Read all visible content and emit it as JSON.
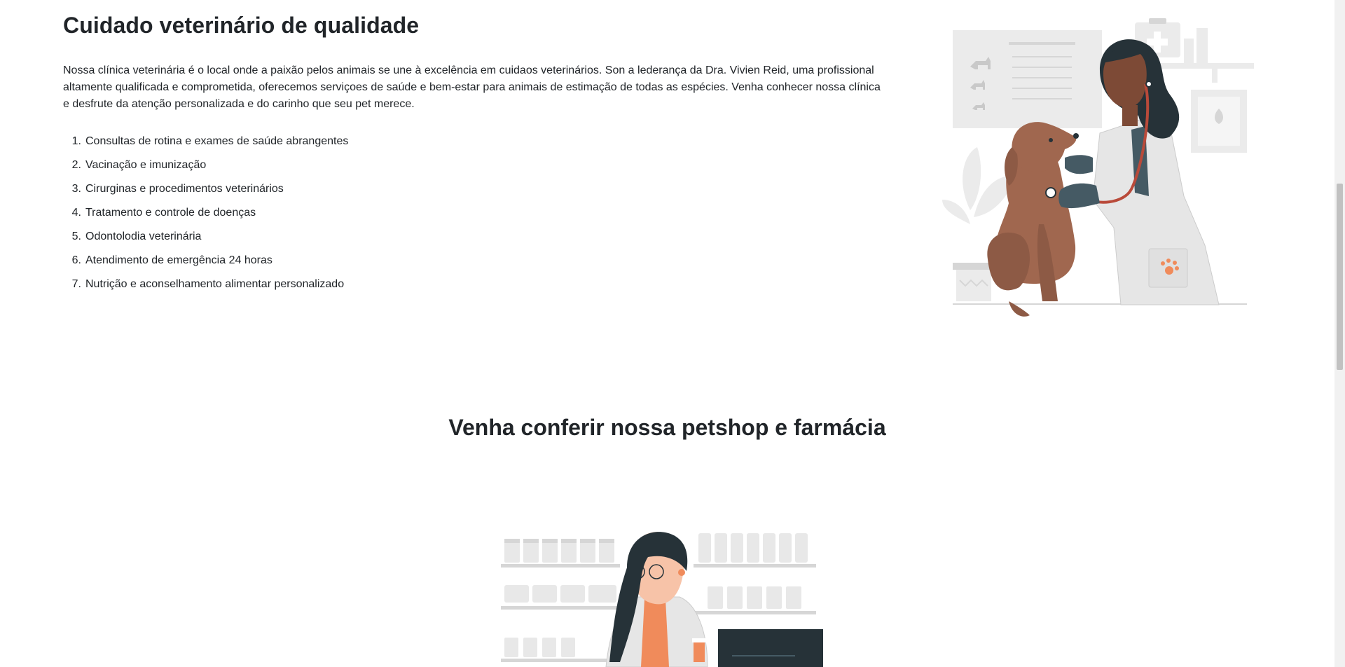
{
  "vet_section": {
    "title": "Cuidado veterinário de qualidade",
    "description": "Nossa clínica veterinária é o local onde a paixão pelos animais se une à excelência em cuidaos veterinários. Son a lederança da Dra. Vivien Reid, uma profissional altamente qualificada e comprometida, oferecemos serviçoes de saúde e bem-estar para animais de estimação de todas as espécies. Venha conhecer nossa clínica e desfrute da atenção personalizada e do carinho que seu pet merece.",
    "services": [
      {
        "number": "1.",
        "label": "Consultas de rotina e exames de saúde abrangentes"
      },
      {
        "number": "2.",
        "label": "Vacinação e imunização"
      },
      {
        "number": "3.",
        "label": "Cirurginas e procedimentos veterinários"
      },
      {
        "number": "4.",
        "label": "Tratamento e controle de doenças"
      },
      {
        "number": "5.",
        "label": "Odontolodia veterinária"
      },
      {
        "number": "6.",
        "label": "Atendimento de emergência 24 horas"
      },
      {
        "number": "7.",
        "label": "Nutrição e aconselhamento alimentar personalizado"
      }
    ]
  },
  "petshop_section": {
    "title": "Venha conferir nossa petshop e farmácia"
  },
  "colors": {
    "text": "#212529",
    "dog": "#a0674f",
    "skin": "#7d4a36",
    "accent": "#f08b5b",
    "gray_light": "#ebebeb",
    "gray_mid": "#d6d6d6",
    "dark": "#263238"
  },
  "icons": [
    "vet-doctor-with-dog-illustration",
    "pharmacist-illustration"
  ]
}
